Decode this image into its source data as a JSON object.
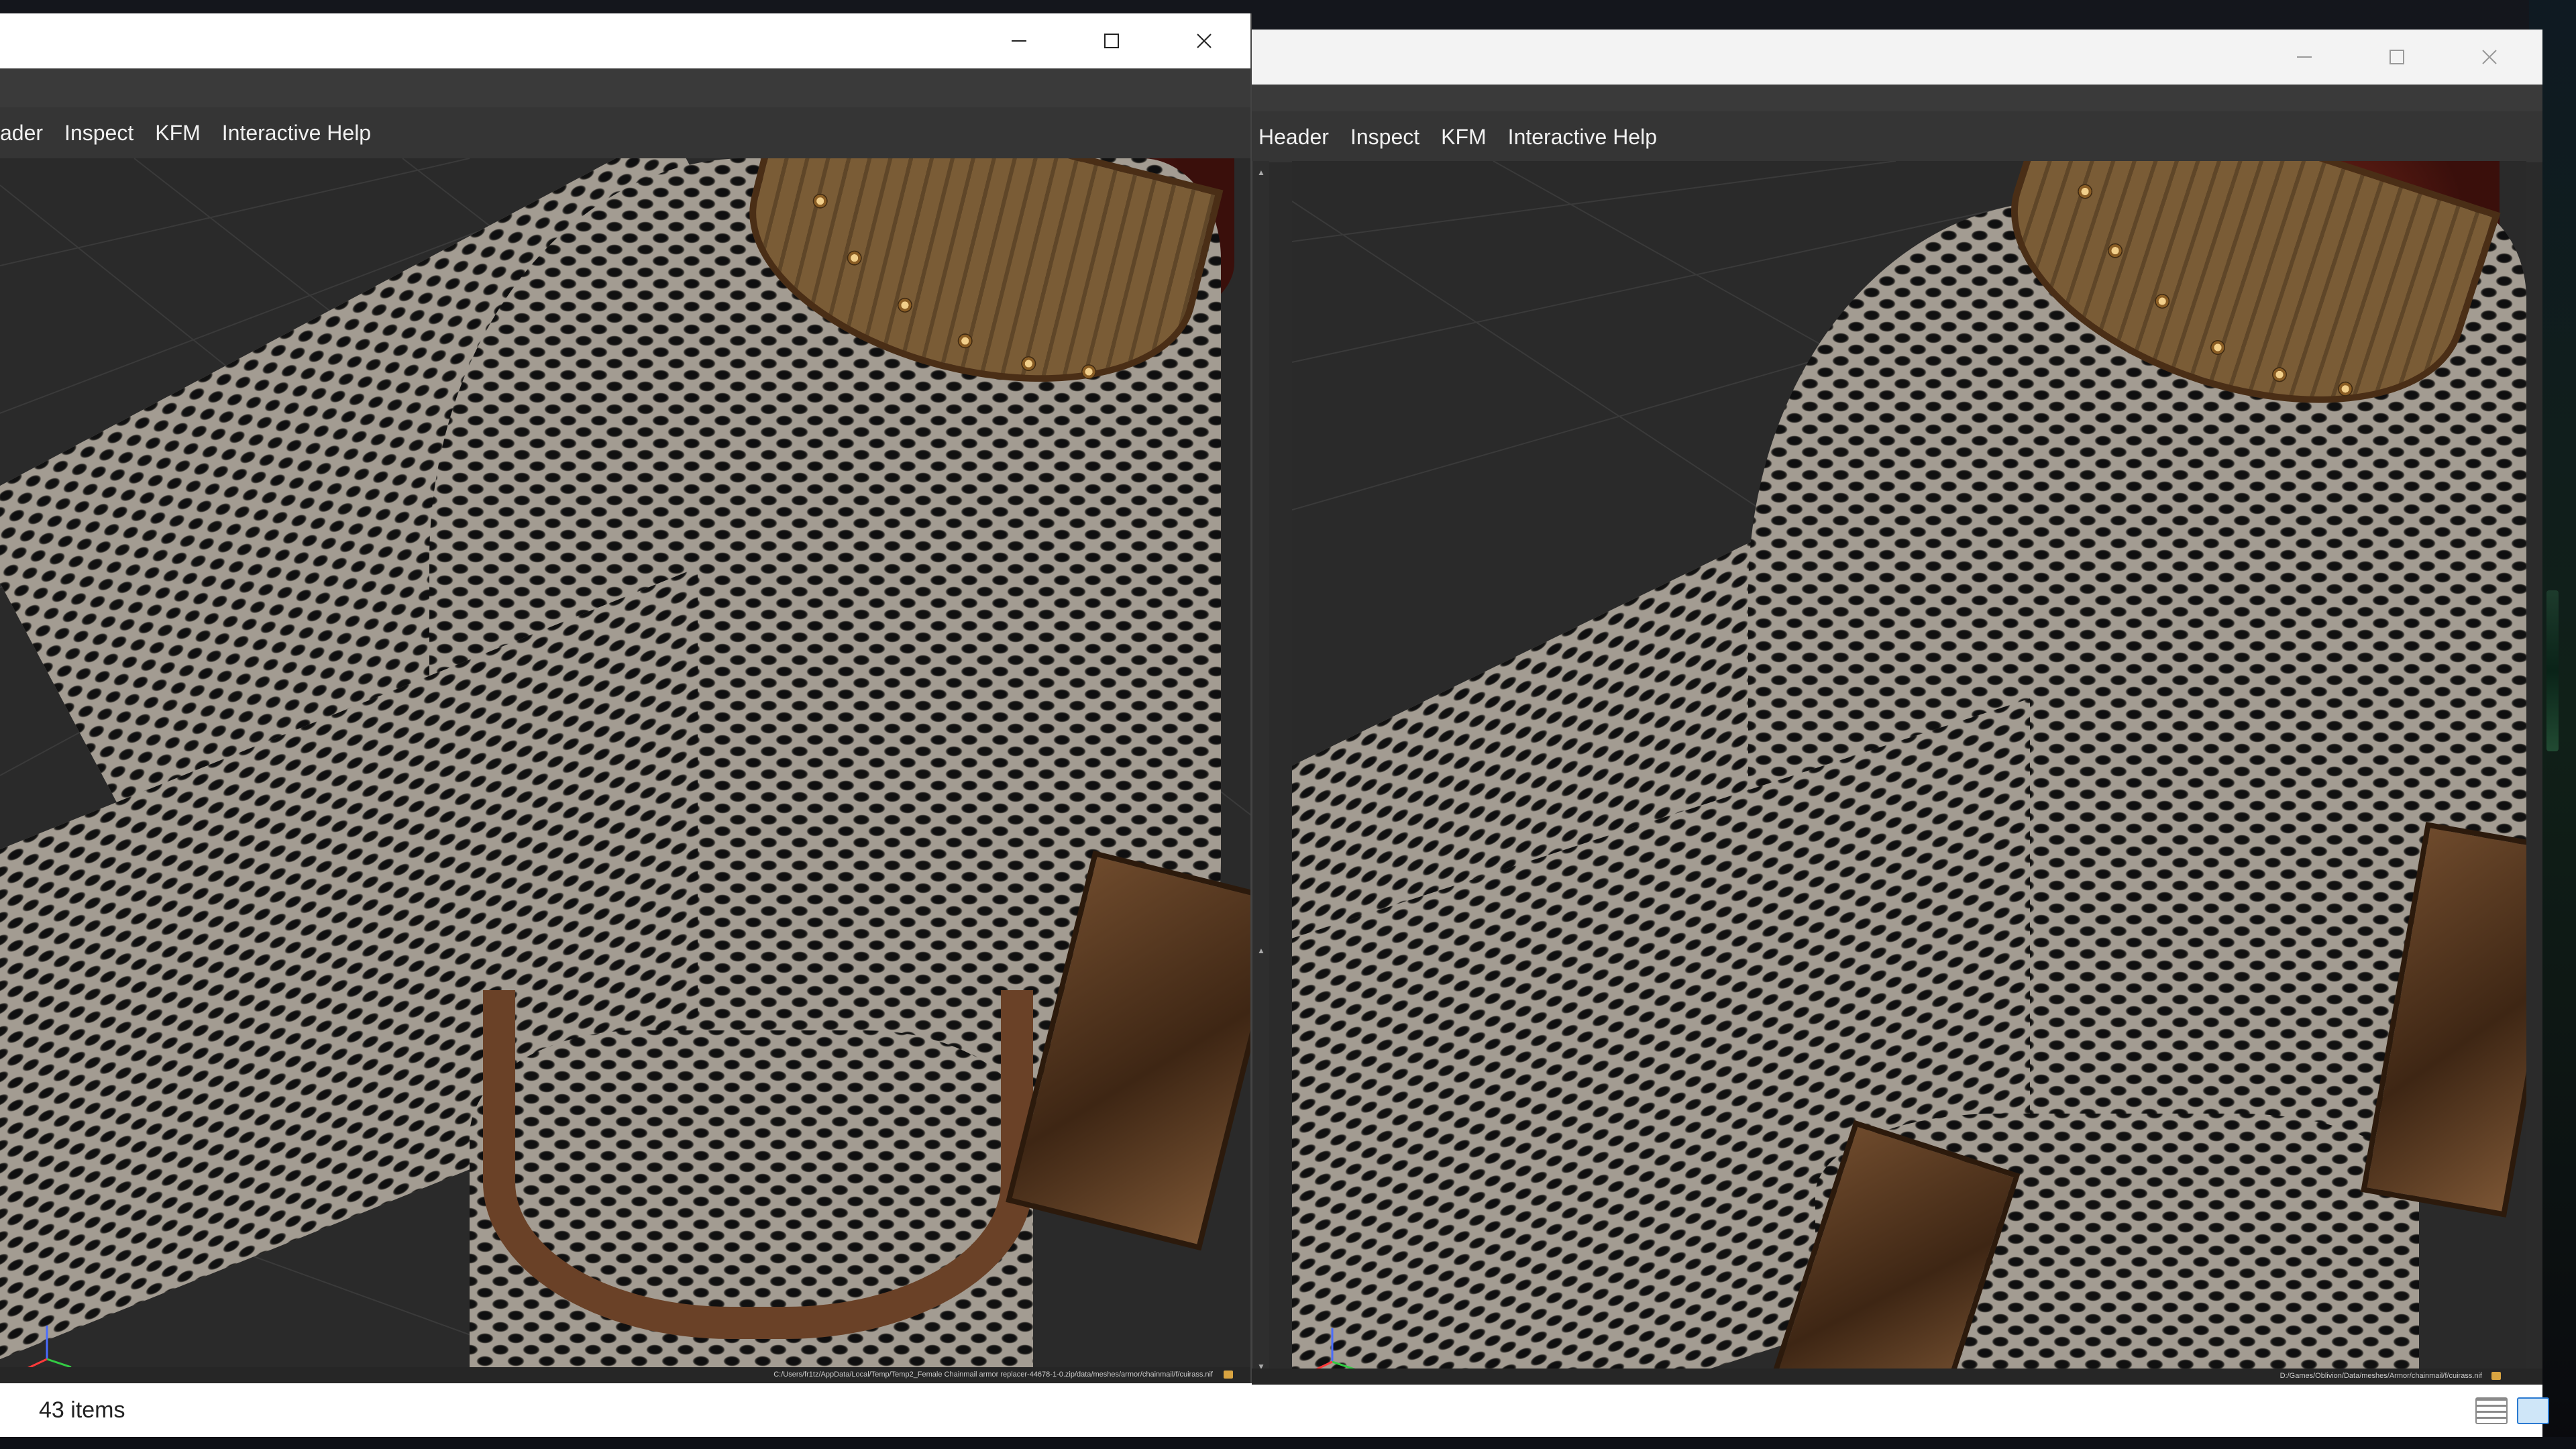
{
  "window_left": {
    "menu": [
      "ader",
      "Inspect",
      "KFM",
      "Interactive Help"
    ],
    "file_path": "C:/Users/fr1tz/AppData/Local/Temp/Temp2_Female Chainmail armor replacer-44678-1-0.zip/data/meshes/armor/chainmail/f/cuirass.nif"
  },
  "window_right": {
    "menu": [
      "Header",
      "Inspect",
      "KFM",
      "Interactive Help"
    ],
    "file_path": "D:/Games/Oblivion/Data/meshes/Armor/chainmail/f/cuirass.nif"
  },
  "explorer": {
    "item_count": "43 items"
  },
  "icons": {
    "minimize": "minimize-icon",
    "maximize": "maximize-icon",
    "close": "close-icon",
    "axes": "xyz-axes-icon",
    "folder": "folder-icon"
  },
  "colors": {
    "viewport_bg": "#2a2a2a",
    "menubar_bg": "#353535",
    "chainmail": "#a39c92",
    "leather": "#5a3a1e"
  }
}
